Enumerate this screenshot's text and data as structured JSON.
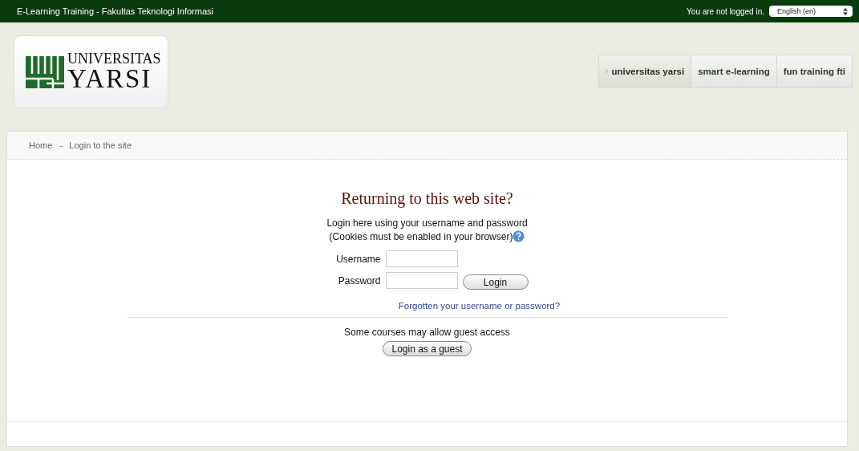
{
  "top_bar": {
    "site_title": "E-Learning Training - Fakultas Teknologi Informasi",
    "login_status": "You are not logged in.",
    "language": {
      "value": "English (en)"
    }
  },
  "logo": {
    "line_1": "UNIVERSITAS",
    "line_2": "YARSI"
  },
  "nav": [
    {
      "label": "universitas yarsi",
      "selected": true
    },
    {
      "label": "smart e-learning",
      "selected": false
    },
    {
      "label": "fun training fti",
      "selected": false
    }
  ],
  "breadcrumb": [
    {
      "label": "Home"
    },
    {
      "label": "Login to the site"
    }
  ],
  "breadcrumb_separator": "→",
  "login": {
    "heading": "Returning to this web site?",
    "intro_1": "Login here using your username and password",
    "intro_2": "(Cookies must be enabled in your browser)",
    "username_label": "Username",
    "password_label": "Password",
    "login_button": "Login",
    "forgot_link": "Forgotten your username or password?",
    "guest_text": "Some courses may allow guest access",
    "guest_button": "Login as a guest"
  }
}
